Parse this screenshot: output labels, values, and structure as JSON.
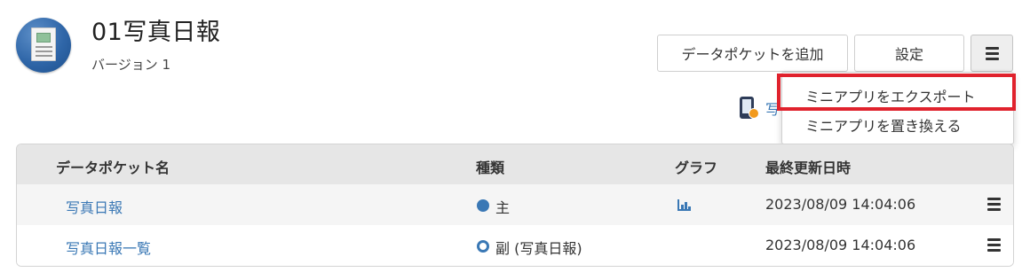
{
  "header": {
    "title": "01写真日報",
    "version": "バージョン 1",
    "icon": "photo-document-icon"
  },
  "toolbar": {
    "add_label": "データポケットを追加",
    "settings_label": "設定",
    "menu_icon": "hamburger-menu-icon"
  },
  "peek": {
    "text": "写",
    "icon": "mobile-app-icon"
  },
  "dropdown": {
    "items": [
      {
        "label": "ミニアプリをエクスポート",
        "highlighted": true
      },
      {
        "label": "ミニアプリを置き換える",
        "highlighted": false
      }
    ],
    "highlight_color": "#e0222d"
  },
  "table": {
    "headers": [
      "データポケット名",
      "種類",
      "グラフ",
      "最終更新日時"
    ],
    "rows": [
      {
        "name": "写真日報",
        "type": "主",
        "type_marker": "filled-circle",
        "graph": "bar-chart-icon",
        "updated": "2023/08/09 14:04:06"
      },
      {
        "name": "写真日報一覧",
        "type": "副 (写真日報)",
        "type_marker": "ring-circle",
        "graph": "",
        "updated": "2023/08/09 14:04:06"
      }
    ]
  },
  "colors": {
    "accent": "#3a78b5",
    "header_bg": "#e6e6e6",
    "row_alt_bg": "#f5f5f5"
  }
}
